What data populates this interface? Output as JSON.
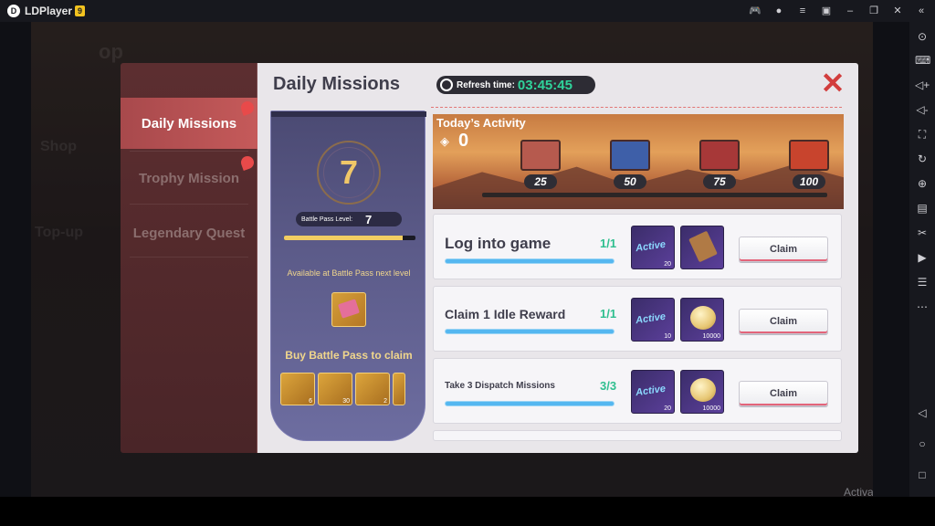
{
  "emulator": {
    "app_name": "LDPlayer",
    "version_badge": "9",
    "watermark": "Activa"
  },
  "background": {
    "shop_label": "Shop",
    "topup_label": "Top-up",
    "op_label": "op"
  },
  "tabs": [
    {
      "label": "Daily Missions",
      "active": true
    },
    {
      "label": "Trophy Mission",
      "active": false
    },
    {
      "label": "Legendary Quest",
      "active": false
    }
  ],
  "header": {
    "title": "Daily Missions",
    "refresh_label": "Refresh time:",
    "refresh_time": "03:45:45"
  },
  "battle_pass": {
    "level_big": "7",
    "level_label": "Battle Pass Level:",
    "level_value": "7",
    "progress": 0.9,
    "next_level_text": "Available at Battle Pass next level",
    "buy_text": "Buy Battle Pass to claim",
    "items": [
      {
        "count": "6"
      },
      {
        "count": "30"
      },
      {
        "count": "2"
      },
      {
        "count": ""
      }
    ]
  },
  "activity": {
    "title": "Today’s Activity",
    "score": "0",
    "milestones": [
      "25",
      "50",
      "75",
      "100"
    ]
  },
  "missions": [
    {
      "name": "Log into game",
      "count": "1/1",
      "reward1_label": "Active",
      "reward1_count": "20",
      "reward2_count": "",
      "claim": "Claim"
    },
    {
      "name": "Claim 1 Idle Reward",
      "count": "1/1",
      "reward1_label": "Active",
      "reward1_count": "10",
      "reward2_count": "10000",
      "claim": "Claim"
    },
    {
      "name": "Take 3 Dispatch Missions",
      "count": "3/3",
      "reward1_label": "Active",
      "reward1_count": "20",
      "reward2_count": "10000",
      "claim": "Claim"
    }
  ]
}
